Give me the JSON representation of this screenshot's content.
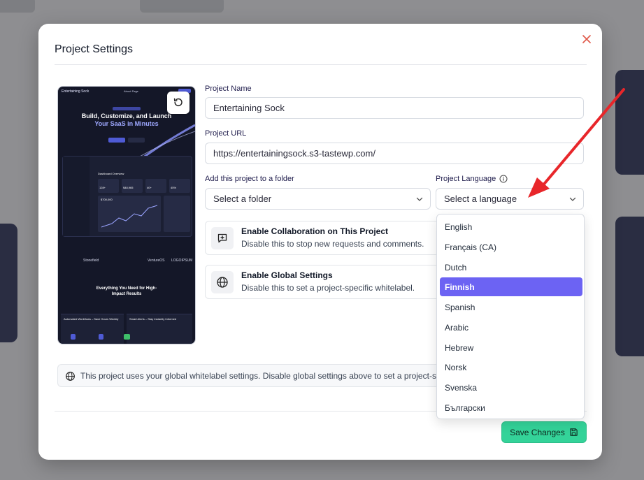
{
  "modal": {
    "title": "Project Settings"
  },
  "preview": {
    "site_name": "Entertaining Sock",
    "nav_link": "About Page",
    "hero_line1": "Build, Customize, and Launch",
    "hero_line2": "Your SaaS in Minutes",
    "dashboard_title": "Dashboard Overview",
    "stat_1": "128+",
    "stat_2": "$48,965",
    "stat_3": "40+",
    "stat_4": "45%",
    "chart_value": "$700,000",
    "logos": [
      "Stonefield",
      "VentureOS",
      "LOGOIPSUM"
    ],
    "feature_line1": "Everything You Need for High-",
    "feature_line2": "Impact Results",
    "footer_card1": "Automated Workflows – Save Hours Weekly",
    "footer_card2": "Smart Alerts – Stay Instantly Informed"
  },
  "form": {
    "project_name_label": "Project Name",
    "project_name_value": "Entertaining Sock",
    "project_url_label": "Project URL",
    "project_url_value": "https://entertainingsock.s3-tastewp.com/",
    "folder_label": "Add this project to a folder",
    "folder_placeholder": "Select a folder",
    "language_label": "Project Language",
    "language_placeholder": "Select a language"
  },
  "toggles": [
    {
      "title": "Enable Collaboration on This Project",
      "description": "Disable this to stop new requests and comments."
    },
    {
      "title": "Enable Global Settings",
      "description": "Disable this to set a project-specific whitelabel."
    }
  ],
  "info": {
    "text": "This project uses your global whitelabel settings. Disable global settings above to set a project-specific whitelabel."
  },
  "footer": {
    "save_label": "Save Changes"
  },
  "language_dropdown": {
    "selected": "Finnish",
    "options": [
      "English",
      "Français (CA)",
      "Dutch",
      "Finnish",
      "Spanish",
      "Arabic",
      "Hebrew",
      "Norsk",
      "Svenska",
      "Български"
    ]
  },
  "colors": {
    "accent": "#6c63f3",
    "save_button": "#34d399",
    "close_icon": "#e05a4b",
    "annotation_arrow": "#e8262a"
  }
}
